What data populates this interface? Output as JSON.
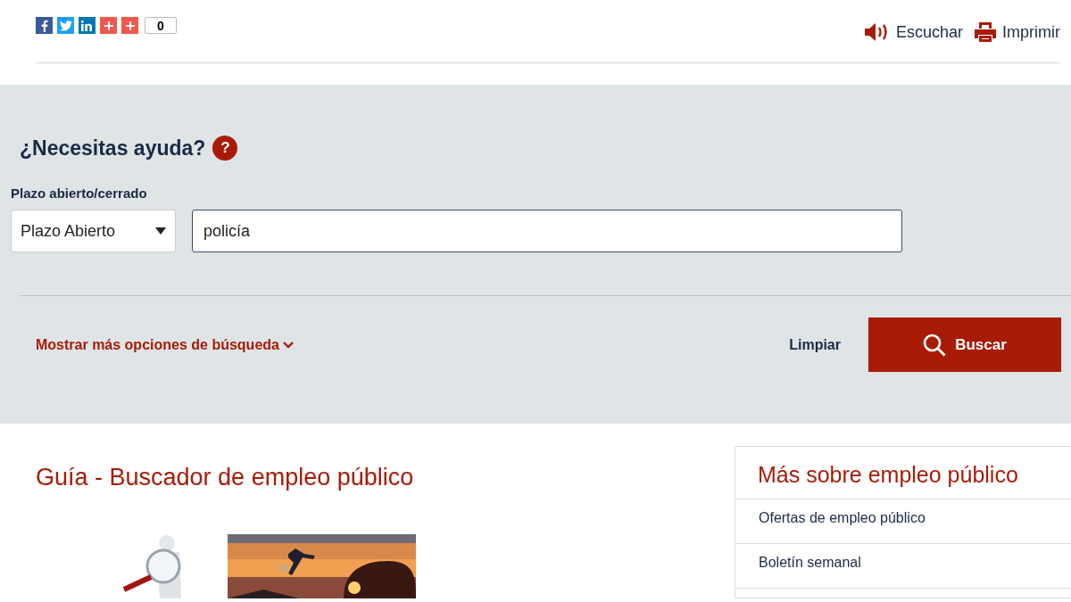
{
  "share": {
    "buttons": [
      {
        "kind": "facebook"
      },
      {
        "kind": "twitter"
      },
      {
        "kind": "linkedin"
      },
      {
        "kind": "plus"
      },
      {
        "kind": "plus"
      }
    ],
    "count": "0"
  },
  "tools": [
    {
      "kind": "listen",
      "label": "Escuchar"
    },
    {
      "kind": "print",
      "label": "Imprimir"
    }
  ],
  "search": {
    "title": "¿Necesitas ayuda?",
    "help": "?",
    "status_label": "Plazo abierto/cerrado",
    "status_value": "Plazo Abierto",
    "query": "policía",
    "more_options": "Mostrar más opciones de búsqueda",
    "clear": "Limpiar",
    "submit": "Buscar"
  },
  "guide": {
    "title": "Guía - Buscador de empleo público"
  },
  "sidebar": {
    "title": "Más sobre empleo público",
    "items": [
      "Ofertas de empleo público",
      "Boletín semanal"
    ]
  }
}
